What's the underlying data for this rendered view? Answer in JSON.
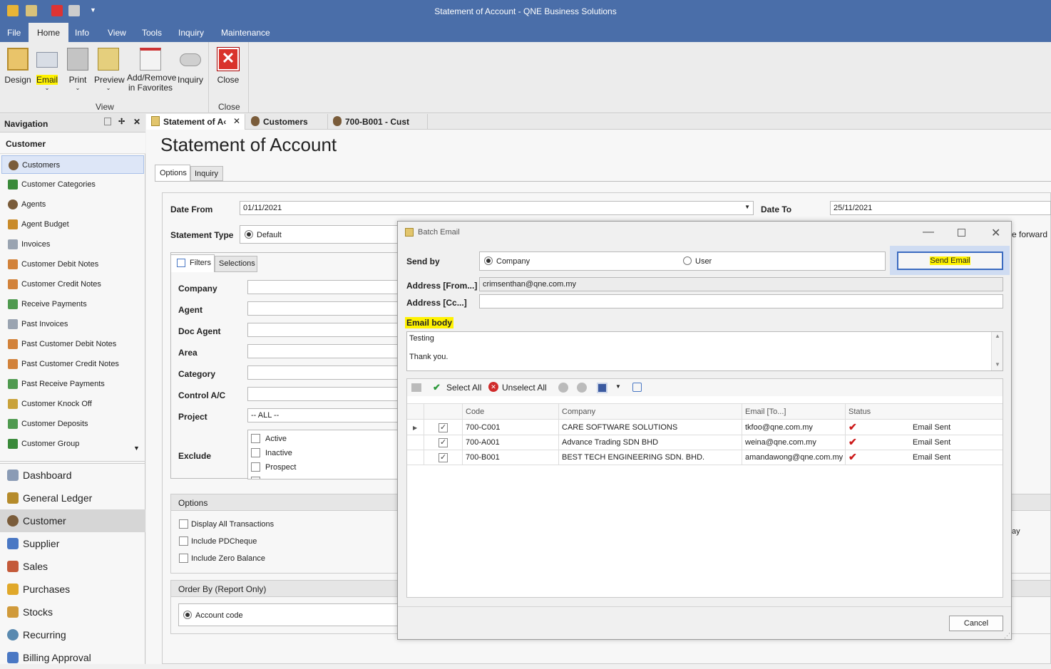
{
  "window": {
    "title": "Statement of Account - QNE Business Solutions"
  },
  "menu": [
    "File",
    "Home",
    "Info",
    "View",
    "Tools",
    "Inquiry",
    "Maintenance"
  ],
  "ribbon": {
    "buttons": [
      "Design",
      "Email",
      "Print",
      "Preview",
      "Add/Remove",
      "in Favorites",
      "Inquiry",
      "Close"
    ],
    "groups": {
      "view": "View",
      "close": "Close"
    }
  },
  "nav": {
    "title": "Navigation",
    "section": "Customer",
    "items": [
      "Customers",
      "Customer Categories",
      "Agents",
      "Agent Budget",
      "Invoices",
      "Customer Debit Notes",
      "Customer Credit Notes",
      "Receive Payments",
      "Past Invoices",
      "Past Customer Debit Notes",
      "Past Customer Credit Notes",
      "Past Receive Payments",
      "Customer Knock Off",
      "Customer Deposits",
      "Customer Group"
    ],
    "modules": [
      "Dashboard",
      "General Ledger",
      "Customer",
      "Supplier",
      "Sales",
      "Purchases",
      "Stocks",
      "Recurring",
      "Billing Approval"
    ]
  },
  "doctabs": [
    "Statement of A‹",
    "Customers",
    "700-B001 - Cust"
  ],
  "page": {
    "title": "Statement of Account",
    "subtabs": [
      "Options",
      "Inquiry"
    ],
    "date_from_label": "Date From",
    "date_from": "01/11/2021",
    "date_to_label": "Date To",
    "date_to": "25/11/2021",
    "statement_type_label": "Statement Type",
    "statement_type": "Default",
    "bf_fragment": "e forward",
    "filter_tabs": [
      "Filters",
      "Selections"
    ],
    "filters": [
      "Company",
      "Agent",
      "Doc Agent",
      "Area",
      "Category",
      "Control A/C",
      "Project",
      "Exclude"
    ],
    "project_value": "-- ALL --",
    "exclude_options": [
      "Active",
      "Inactive",
      "Prospect"
    ],
    "options_header": "Options",
    "options": [
      "Display All Transactions",
      "Include PDCheque",
      "Include Zero Balance"
    ],
    "right_fragment": "ay",
    "order_header": "Order By (Report Only)",
    "order_value": "Account code"
  },
  "dialog": {
    "title": "Batch Email",
    "send_by_label": "Send by",
    "send_by_options": [
      "Company",
      "User"
    ],
    "send_button": "Send Email",
    "from_label": "Address [From...]",
    "from_value": "crimsenthan@qne.com.my",
    "cc_label": "Address [Cc...]",
    "cc_value": "",
    "body_label": "Email body",
    "body_line1": "Testing",
    "body_line2": "Thank you.",
    "toolbar": {
      "select_all": "Select All",
      "unselect_all": "Unselect All"
    },
    "columns": [
      "Code",
      "Company",
      "Email [To...]",
      "Status"
    ],
    "rows": [
      {
        "code": "700-C001",
        "company": "CARE SOFTWARE SOLUTIONS",
        "email": "tkfoo@qne.com.my",
        "status": "Email Sent"
      },
      {
        "code": "700-A001",
        "company": "Advance Trading SDN BHD",
        "email": "weina@qne.com.my",
        "status": "Email Sent"
      },
      {
        "code": "700-B001",
        "company": "BEST TECH ENGINEERING SDN. BHD.",
        "email": "amandawong@qne.com.my",
        "status": "Email Sent"
      }
    ],
    "cancel": "Cancel"
  },
  "colors": {
    "titlebar": "#4a6ea9",
    "highlight": "#fff200",
    "status_tick": "#cc1a1a"
  }
}
